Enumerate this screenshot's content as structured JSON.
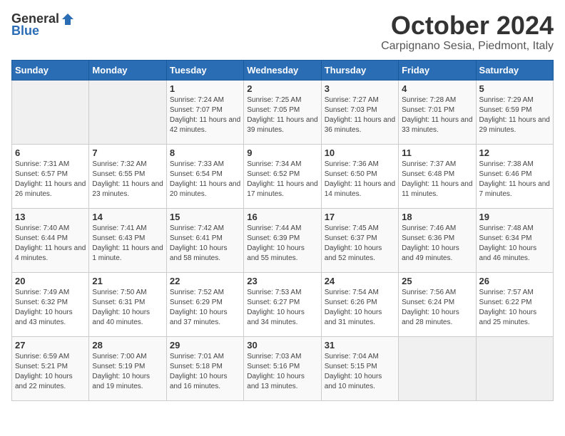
{
  "header": {
    "logo_general": "General",
    "logo_blue": "Blue",
    "month_title": "October 2024",
    "location": "Carpignano Sesia, Piedmont, Italy"
  },
  "days_of_week": [
    "Sunday",
    "Monday",
    "Tuesday",
    "Wednesday",
    "Thursday",
    "Friday",
    "Saturday"
  ],
  "weeks": [
    [
      {
        "day": "",
        "sunrise": "",
        "sunset": "",
        "daylight": ""
      },
      {
        "day": "",
        "sunrise": "",
        "sunset": "",
        "daylight": ""
      },
      {
        "day": "1",
        "sunrise": "Sunrise: 7:24 AM",
        "sunset": "Sunset: 7:07 PM",
        "daylight": "Daylight: 11 hours and 42 minutes."
      },
      {
        "day": "2",
        "sunrise": "Sunrise: 7:25 AM",
        "sunset": "Sunset: 7:05 PM",
        "daylight": "Daylight: 11 hours and 39 minutes."
      },
      {
        "day": "3",
        "sunrise": "Sunrise: 7:27 AM",
        "sunset": "Sunset: 7:03 PM",
        "daylight": "Daylight: 11 hours and 36 minutes."
      },
      {
        "day": "4",
        "sunrise": "Sunrise: 7:28 AM",
        "sunset": "Sunset: 7:01 PM",
        "daylight": "Daylight: 11 hours and 33 minutes."
      },
      {
        "day": "5",
        "sunrise": "Sunrise: 7:29 AM",
        "sunset": "Sunset: 6:59 PM",
        "daylight": "Daylight: 11 hours and 29 minutes."
      }
    ],
    [
      {
        "day": "6",
        "sunrise": "Sunrise: 7:31 AM",
        "sunset": "Sunset: 6:57 PM",
        "daylight": "Daylight: 11 hours and 26 minutes."
      },
      {
        "day": "7",
        "sunrise": "Sunrise: 7:32 AM",
        "sunset": "Sunset: 6:55 PM",
        "daylight": "Daylight: 11 hours and 23 minutes."
      },
      {
        "day": "8",
        "sunrise": "Sunrise: 7:33 AM",
        "sunset": "Sunset: 6:54 PM",
        "daylight": "Daylight: 11 hours and 20 minutes."
      },
      {
        "day": "9",
        "sunrise": "Sunrise: 7:34 AM",
        "sunset": "Sunset: 6:52 PM",
        "daylight": "Daylight: 11 hours and 17 minutes."
      },
      {
        "day": "10",
        "sunrise": "Sunrise: 7:36 AM",
        "sunset": "Sunset: 6:50 PM",
        "daylight": "Daylight: 11 hours and 14 minutes."
      },
      {
        "day": "11",
        "sunrise": "Sunrise: 7:37 AM",
        "sunset": "Sunset: 6:48 PM",
        "daylight": "Daylight: 11 hours and 11 minutes."
      },
      {
        "day": "12",
        "sunrise": "Sunrise: 7:38 AM",
        "sunset": "Sunset: 6:46 PM",
        "daylight": "Daylight: 11 hours and 7 minutes."
      }
    ],
    [
      {
        "day": "13",
        "sunrise": "Sunrise: 7:40 AM",
        "sunset": "Sunset: 6:44 PM",
        "daylight": "Daylight: 11 hours and 4 minutes."
      },
      {
        "day": "14",
        "sunrise": "Sunrise: 7:41 AM",
        "sunset": "Sunset: 6:43 PM",
        "daylight": "Daylight: 11 hours and 1 minute."
      },
      {
        "day": "15",
        "sunrise": "Sunrise: 7:42 AM",
        "sunset": "Sunset: 6:41 PM",
        "daylight": "Daylight: 10 hours and 58 minutes."
      },
      {
        "day": "16",
        "sunrise": "Sunrise: 7:44 AM",
        "sunset": "Sunset: 6:39 PM",
        "daylight": "Daylight: 10 hours and 55 minutes."
      },
      {
        "day": "17",
        "sunrise": "Sunrise: 7:45 AM",
        "sunset": "Sunset: 6:37 PM",
        "daylight": "Daylight: 10 hours and 52 minutes."
      },
      {
        "day": "18",
        "sunrise": "Sunrise: 7:46 AM",
        "sunset": "Sunset: 6:36 PM",
        "daylight": "Daylight: 10 hours and 49 minutes."
      },
      {
        "day": "19",
        "sunrise": "Sunrise: 7:48 AM",
        "sunset": "Sunset: 6:34 PM",
        "daylight": "Daylight: 10 hours and 46 minutes."
      }
    ],
    [
      {
        "day": "20",
        "sunrise": "Sunrise: 7:49 AM",
        "sunset": "Sunset: 6:32 PM",
        "daylight": "Daylight: 10 hours and 43 minutes."
      },
      {
        "day": "21",
        "sunrise": "Sunrise: 7:50 AM",
        "sunset": "Sunset: 6:31 PM",
        "daylight": "Daylight: 10 hours and 40 minutes."
      },
      {
        "day": "22",
        "sunrise": "Sunrise: 7:52 AM",
        "sunset": "Sunset: 6:29 PM",
        "daylight": "Daylight: 10 hours and 37 minutes."
      },
      {
        "day": "23",
        "sunrise": "Sunrise: 7:53 AM",
        "sunset": "Sunset: 6:27 PM",
        "daylight": "Daylight: 10 hours and 34 minutes."
      },
      {
        "day": "24",
        "sunrise": "Sunrise: 7:54 AM",
        "sunset": "Sunset: 6:26 PM",
        "daylight": "Daylight: 10 hours and 31 minutes."
      },
      {
        "day": "25",
        "sunrise": "Sunrise: 7:56 AM",
        "sunset": "Sunset: 6:24 PM",
        "daylight": "Daylight: 10 hours and 28 minutes."
      },
      {
        "day": "26",
        "sunrise": "Sunrise: 7:57 AM",
        "sunset": "Sunset: 6:22 PM",
        "daylight": "Daylight: 10 hours and 25 minutes."
      }
    ],
    [
      {
        "day": "27",
        "sunrise": "Sunrise: 6:59 AM",
        "sunset": "Sunset: 5:21 PM",
        "daylight": "Daylight: 10 hours and 22 minutes."
      },
      {
        "day": "28",
        "sunrise": "Sunrise: 7:00 AM",
        "sunset": "Sunset: 5:19 PM",
        "daylight": "Daylight: 10 hours and 19 minutes."
      },
      {
        "day": "29",
        "sunrise": "Sunrise: 7:01 AM",
        "sunset": "Sunset: 5:18 PM",
        "daylight": "Daylight: 10 hours and 16 minutes."
      },
      {
        "day": "30",
        "sunrise": "Sunrise: 7:03 AM",
        "sunset": "Sunset: 5:16 PM",
        "daylight": "Daylight: 10 hours and 13 minutes."
      },
      {
        "day": "31",
        "sunrise": "Sunrise: 7:04 AM",
        "sunset": "Sunset: 5:15 PM",
        "daylight": "Daylight: 10 hours and 10 minutes."
      },
      {
        "day": "",
        "sunrise": "",
        "sunset": "",
        "daylight": ""
      },
      {
        "day": "",
        "sunrise": "",
        "sunset": "",
        "daylight": ""
      }
    ]
  ]
}
